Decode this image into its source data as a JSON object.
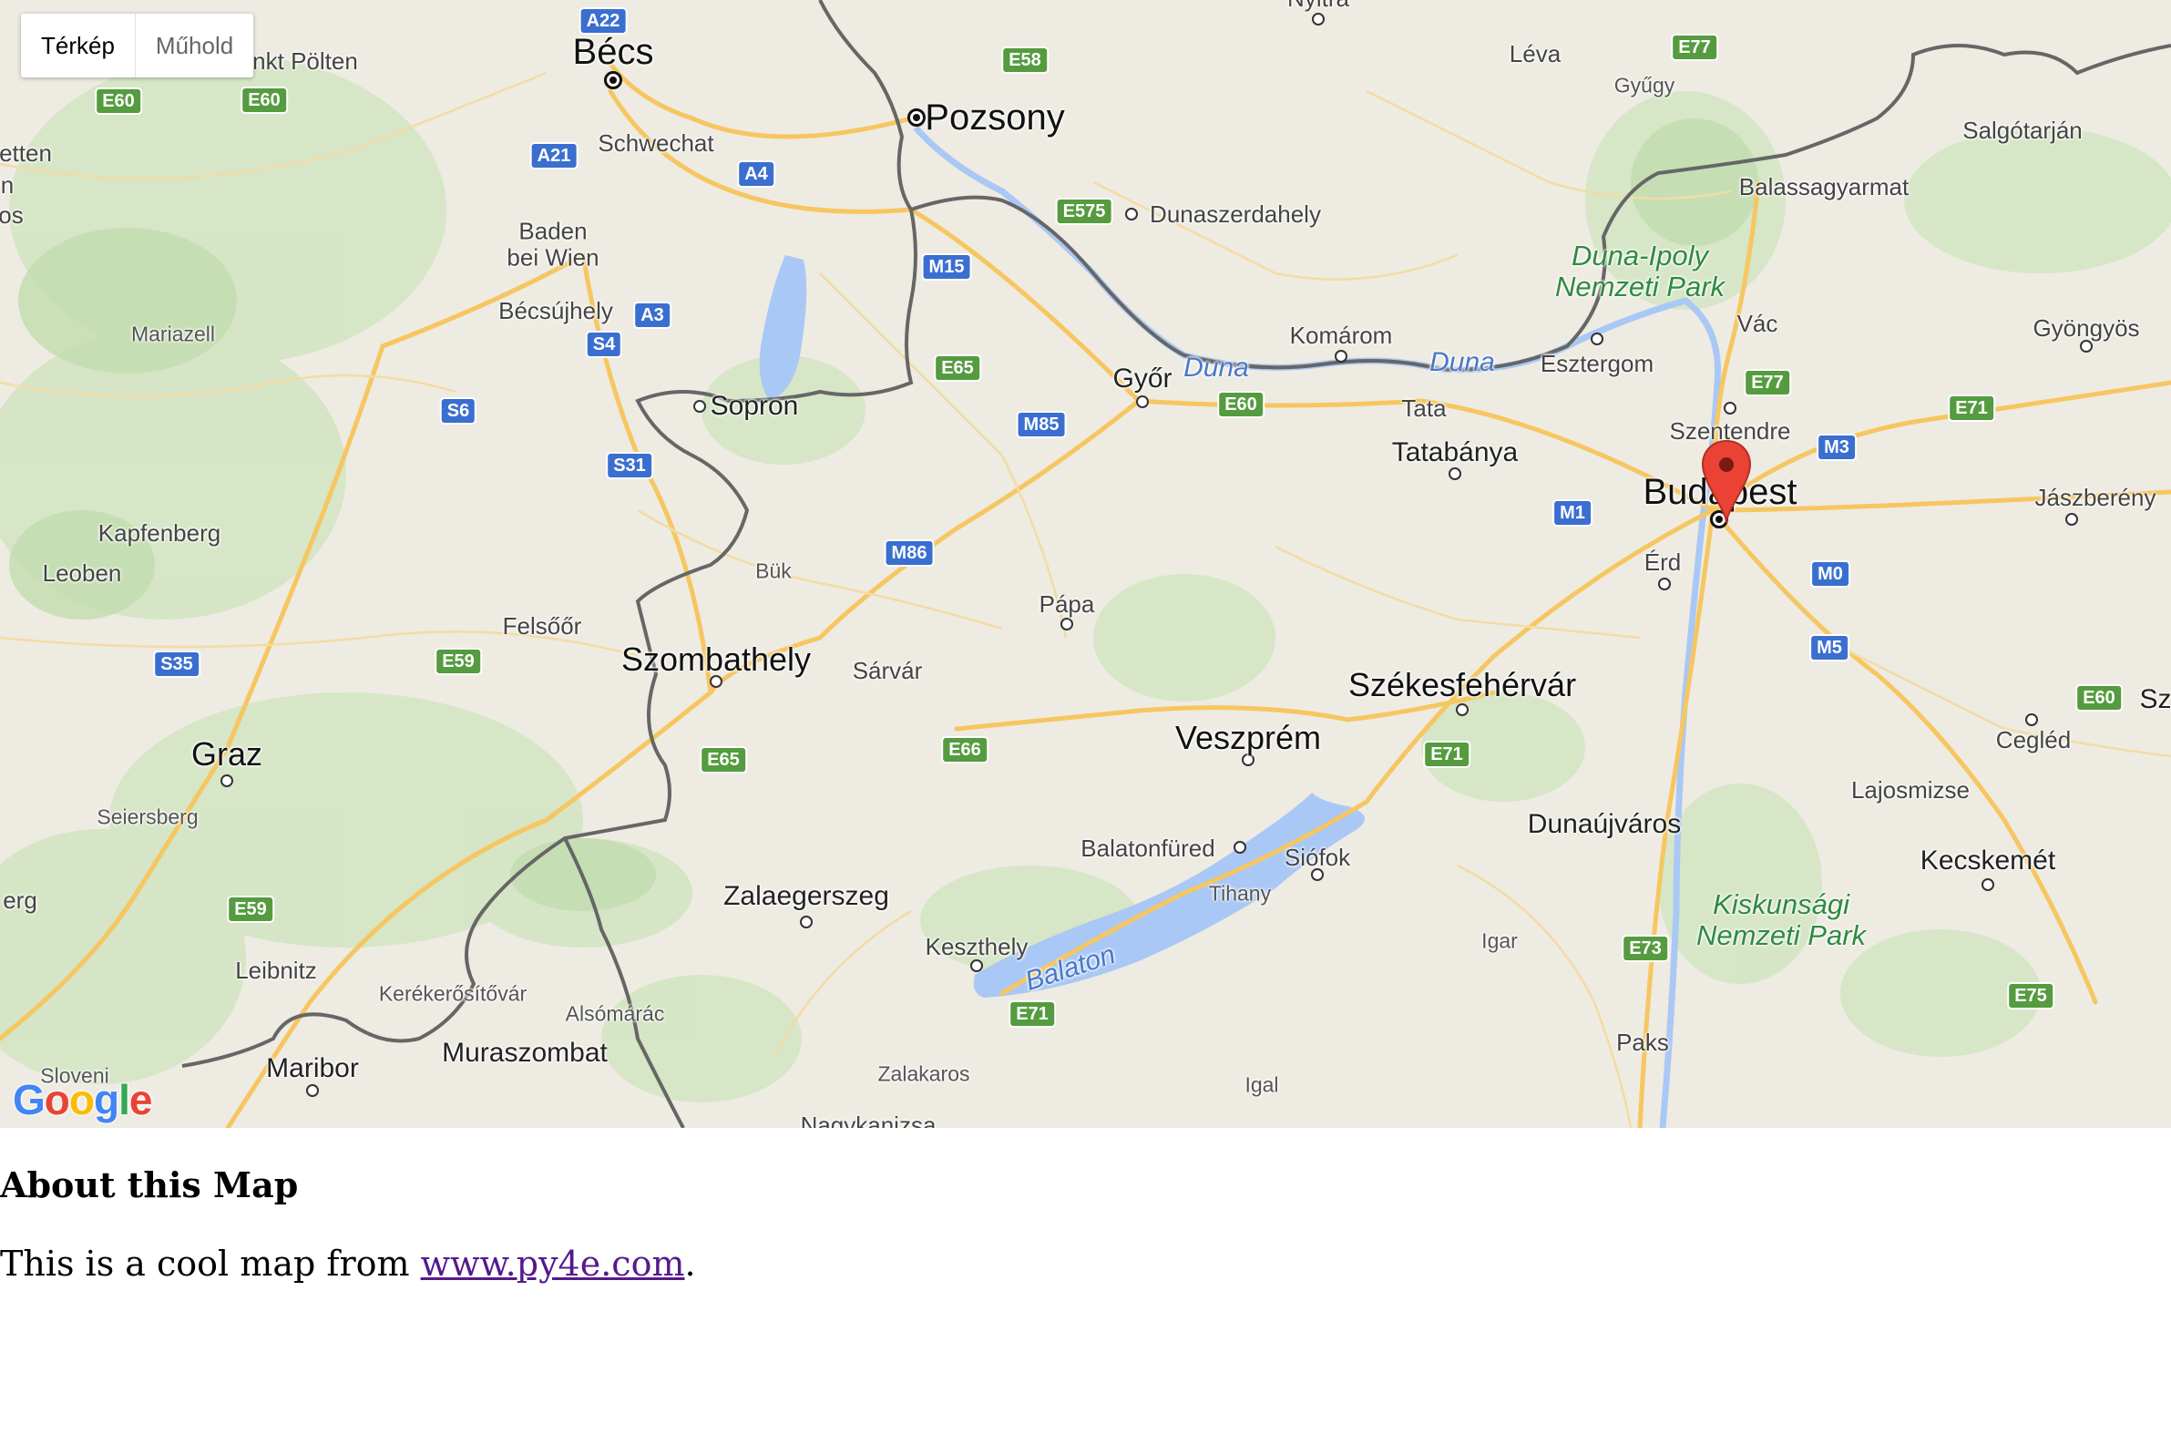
{
  "map": {
    "map_type_control": {
      "options": [
        "Térkép",
        "Műhold"
      ],
      "selected": "Térkép"
    },
    "logo": "Google",
    "marker": {
      "place": "Budapest",
      "color": "#ea4335"
    },
    "cities": {
      "becs": "Bécs",
      "pozsony": "Pozsony",
      "budapest": "Budapest",
      "graz": "Graz",
      "szombathely": "Szombathely",
      "szekesfehervar": "Székesfehérvár",
      "veszprem": "Veszprém",
      "zalaegerszeg": "Zalaegerszeg",
      "kecskemet": "Kecskemét",
      "gyor": "Győr",
      "sopron": "Sopron",
      "maribor": "Maribor",
      "muraszombat": "Muraszombat",
      "tatabanya": "Tatabánya",
      "dunaujvaros": "Dunaújváros",
      "salgotarjan": "Salgótarján",
      "balassagyarmat": "Balassagyarmat",
      "esztergom": "Esztergom",
      "komarom": "Komárom",
      "tata": "Tata",
      "vac": "Vác",
      "szentendre": "Szentendre",
      "erd": "Érd",
      "gyongyos": "Gyöngyös",
      "jaszbereny": "Jászberény",
      "cegled": "Cegléd",
      "lajosmizse": "Lajosmizse",
      "paks": "Paks",
      "siofok": "Siófok",
      "balatonfured": "Balatonfüred",
      "keszthely": "Keszthely",
      "papa": "Pápa",
      "sarvar": "Sárvár",
      "buk": "Bük",
      "felsoor": "Felsőőr",
      "kapfenberg": "Kapfenberg",
      "leoben": "Leoben",
      "mariazell": "Mariazell",
      "becsujhely": "Bécsújhely",
      "baden": "Baden\nbei Wien",
      "schwechat": "Schwechat",
      "stpolten": "nkt Pölten",
      "dunaszerdahely": "Dunaszerdahely",
      "leva": "Léva",
      "gyugy": "Gyűgy",
      "nyitra": "Nyitra",
      "tihany": "Tihany",
      "igar": "Igar",
      "igal": "Igal",
      "zalakaros": "Zalakaros",
      "nagykanizsa": "Nagykanizsa",
      "leibnitz": "Leibnitz",
      "seiersberg": "Seiersberg",
      "kerekerositovar": "Kerékerősítővár",
      "alsomarac": "Alsómárác",
      "sloveni": "Sloveni",
      "edge_etten": "etten",
      "edge_n": "n",
      "edge_os": "os",
      "edge_erg": "erg",
      "edge_sz": "Sz"
    },
    "parks": {
      "dunaipoly": "Duna-Ipoly\nNemzeti Park",
      "kiskunsagi": "Kiskunsági\nNemzeti Park"
    },
    "water": {
      "duna1": "Duna",
      "duna2": "Duna",
      "balaton": "Balaton"
    },
    "roads": {
      "a22": "A22",
      "e58": "E58",
      "e77a": "E77",
      "e60a": "E60",
      "e60b": "E60",
      "a21": "A21",
      "a4": "A4",
      "e575": "E575",
      "m15": "M15",
      "a3": "A3",
      "s4": "S4",
      "s6": "S6",
      "e65a": "E65",
      "m85": "M85",
      "e60c": "E60",
      "s31": "S31",
      "m86": "M86",
      "e77b": "E77",
      "e71a": "E71",
      "m3": "M3",
      "m1": "M1",
      "m0": "M0",
      "m5": "M5",
      "s35": "S35",
      "e59a": "E59",
      "e65b": "E65",
      "e66": "E66",
      "e71b": "E71",
      "e60d": "E60",
      "e59b": "E59",
      "e71c": "E71",
      "e73": "E73",
      "e75": "E75"
    }
  },
  "about": {
    "title": "About this Map",
    "text_before": "This is a cool map from ",
    "link_text": "www.py4e.com",
    "text_after": "."
  }
}
